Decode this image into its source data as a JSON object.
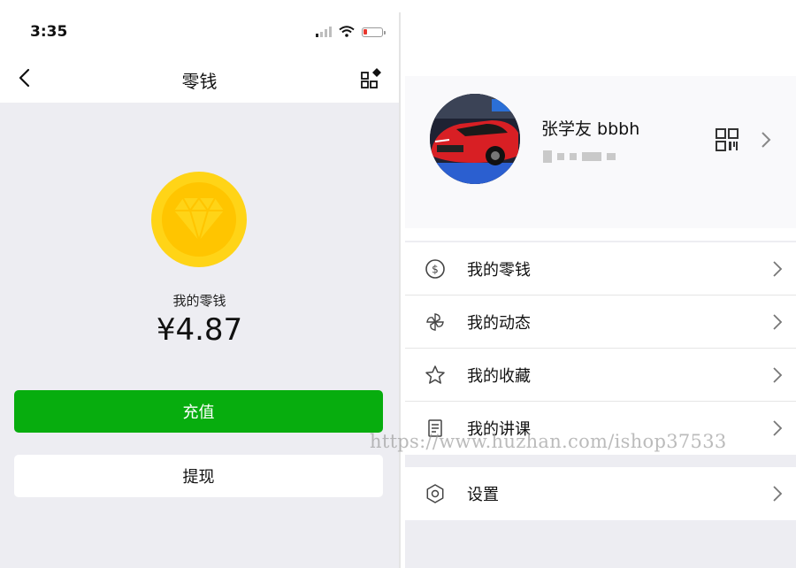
{
  "left": {
    "status": {
      "time": "3:35"
    },
    "nav": {
      "title": "零钱"
    },
    "balance": {
      "label": "我的零钱",
      "amount": "¥4.87"
    },
    "buttons": {
      "topup": "充值",
      "withdraw": "提现"
    }
  },
  "right": {
    "profile": {
      "name": "张学友 bbbh"
    },
    "menu": [
      {
        "label": "我的零钱",
        "icon": "dollar-circle-icon"
      },
      {
        "label": "我的动态",
        "icon": "pinwheel-icon"
      },
      {
        "label": "我的收藏",
        "icon": "star-icon"
      },
      {
        "label": "我的讲课",
        "icon": "document-icon"
      }
    ],
    "settings": {
      "label": "设置",
      "icon": "hexagon-gear-icon"
    }
  },
  "watermark": "https://www.huzhan.com/ishop37533",
  "colors": {
    "primary_green": "#07ad0e",
    "coin_outer": "#ffd417",
    "coin_inner": "#ffc500",
    "page_bg": "#ededf2"
  }
}
